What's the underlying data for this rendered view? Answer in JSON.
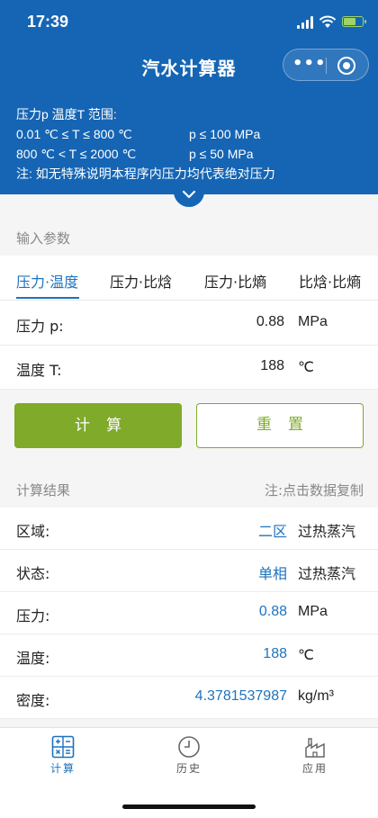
{
  "status": {
    "time": "17:39"
  },
  "app": {
    "title": "汽水计算器",
    "more_glyph": "•••"
  },
  "info_lines": {
    "l1": "压力p 温度T 范围:",
    "l2a": "0.01 ℃ ≤ T ≤ 800 ℃",
    "l2b": "p ≤ 100 MPa",
    "l3a": "800 ℃ < T ≤ 2000 ℃",
    "l3b": "p ≤ 50 MPa",
    "l4": "注: 如无特殊说明本程序内压力均代表绝对压力"
  },
  "input_section": {
    "label": "输入参数"
  },
  "tabs": [
    "压力·温度",
    "压力·比焓",
    "压力·比熵",
    "比焓·比熵"
  ],
  "inputs": {
    "pressure": {
      "label": "压力 p:",
      "value": "0.88",
      "unit": "MPa"
    },
    "temperature": {
      "label": "温度 T:",
      "value": "188",
      "unit": "℃"
    }
  },
  "buttons": {
    "calc": "计算",
    "reset": "重置"
  },
  "results_section": {
    "label": "计算结果",
    "note": "注:点击数据复制"
  },
  "results": [
    {
      "label": "区域:",
      "value": "二区",
      "unit": "过热蒸汽"
    },
    {
      "label": "状态:",
      "value": "单相",
      "unit": "过热蒸汽"
    },
    {
      "label": "压力:",
      "value": "0.88",
      "unit": "MPa"
    },
    {
      "label": "温度:",
      "value": "188",
      "unit": "℃"
    },
    {
      "label": "密度:",
      "value": "4.3781537987",
      "unit": "kg/m³"
    }
  ],
  "tabbar": [
    {
      "label": "计算"
    },
    {
      "label": "历史"
    },
    {
      "label": "应用"
    }
  ],
  "colors": {
    "header": "#1565b4",
    "accent": "#1e73be",
    "green": "#7faa2a"
  }
}
